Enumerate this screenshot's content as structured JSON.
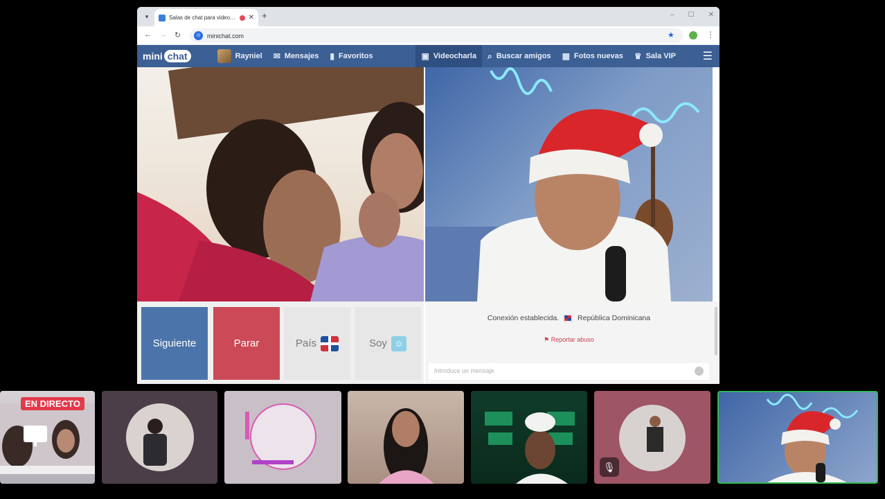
{
  "browser": {
    "tab_title": "Salas de chat para videochat",
    "new_tab": "+",
    "url": "minichat.com",
    "window_controls": [
      "–",
      "☐",
      "✕"
    ]
  },
  "site": {
    "logo": {
      "prefix": "mini",
      "bubble": "chat"
    },
    "nav": {
      "user": "Rayniel",
      "messages": "Mensajes",
      "favorites": "Favoritos",
      "videochat": "Videocharla",
      "find_friends": "Buscar amigos",
      "new_photos": "Fotos nuevas",
      "vip": "Sala VIP"
    }
  },
  "controls": {
    "next": "Siguiente",
    "stop": "Parar",
    "country": "País",
    "gender": "Soy"
  },
  "chat": {
    "status": "Conexión establecida.",
    "country_name": "República Dominicana",
    "report": "Reportar abuso",
    "placeholder": "Introduce un mensaje"
  },
  "stream": {
    "live_badge": "EN DIRECTO"
  },
  "colors": {
    "nav_blue": "#3c5f94",
    "next_btn": "#4b74ab",
    "stop_btn": "#cc4a57",
    "live_red": "#e23a4d",
    "active_speaker": "#2fb655"
  }
}
